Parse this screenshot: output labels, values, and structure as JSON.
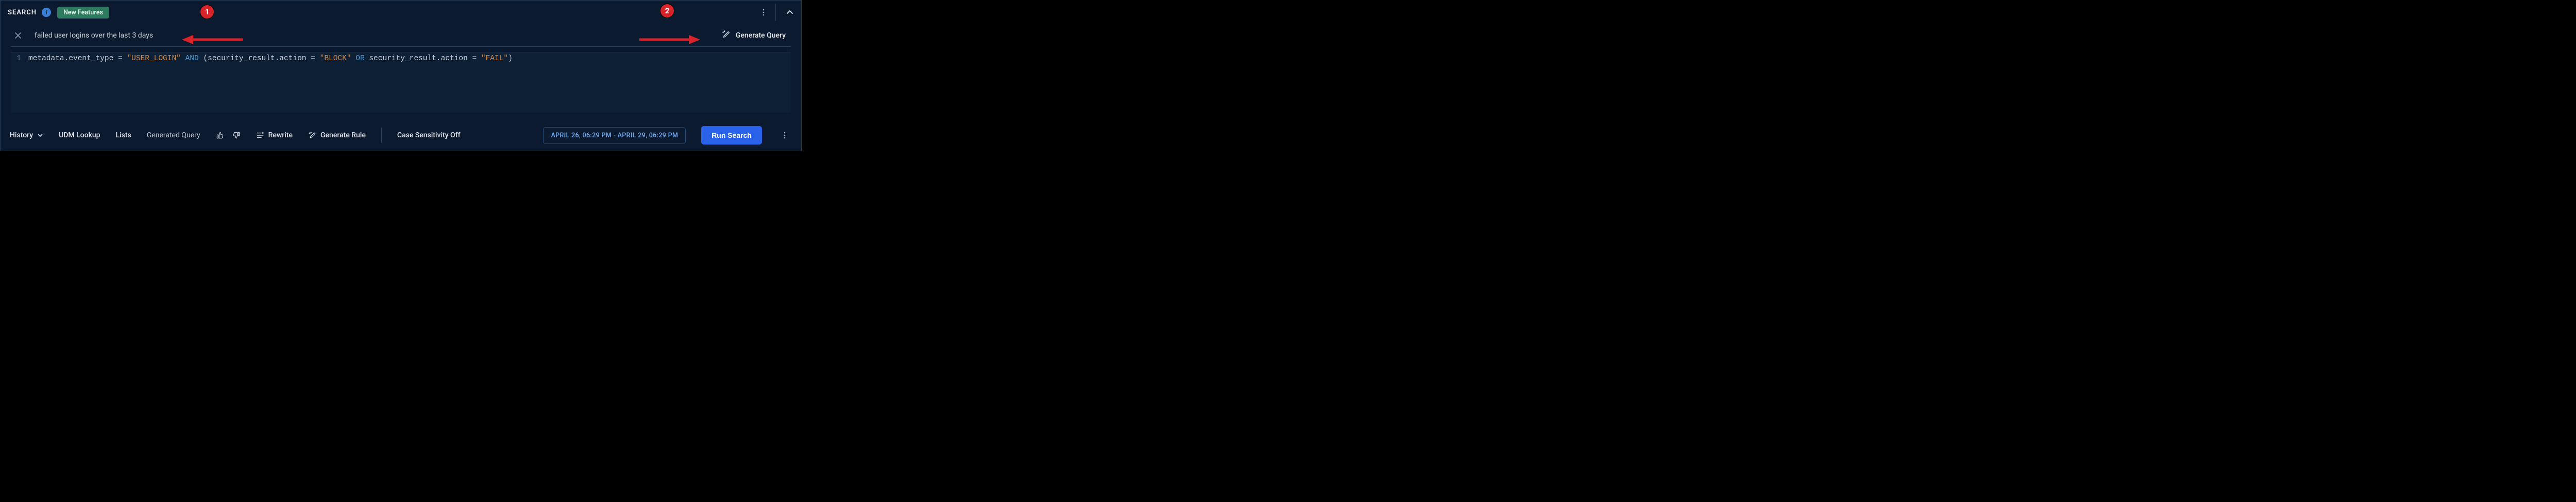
{
  "header": {
    "title": "SEARCH",
    "new_features_label": "New Features"
  },
  "nl_input": {
    "text": "failed user logins over the last 3 days",
    "generate_button": "Generate Query"
  },
  "editor": {
    "line_number": "1",
    "tokens": [
      {
        "t": "metadata.event_type = ",
        "c": ""
      },
      {
        "t": "\"USER_LOGIN\"",
        "c": "tk-str"
      },
      {
        "t": " ",
        "c": ""
      },
      {
        "t": "AND",
        "c": "tk-kw"
      },
      {
        "t": " (security_result.action = ",
        "c": ""
      },
      {
        "t": "\"BLOCK\"",
        "c": "tk-str"
      },
      {
        "t": " ",
        "c": ""
      },
      {
        "t": "OR",
        "c": "tk-kw"
      },
      {
        "t": " security_result.action = ",
        "c": ""
      },
      {
        "t": "\"FAIL\"",
        "c": "tk-str"
      },
      {
        "t": ")",
        "c": ""
      }
    ]
  },
  "footer": {
    "history": "History",
    "udm_lookup": "UDM Lookup",
    "lists": "Lists",
    "generated_query": "Generated Query",
    "rewrite": "Rewrite",
    "generate_rule": "Generate Rule",
    "case_sensitivity": "Case Sensitivity Off",
    "date_range": "APRIL 26, 06:29 PM - APRIL 29, 06:29 PM",
    "run_search": "Run Search"
  },
  "annotations": {
    "badge1": "1",
    "badge2": "2"
  }
}
